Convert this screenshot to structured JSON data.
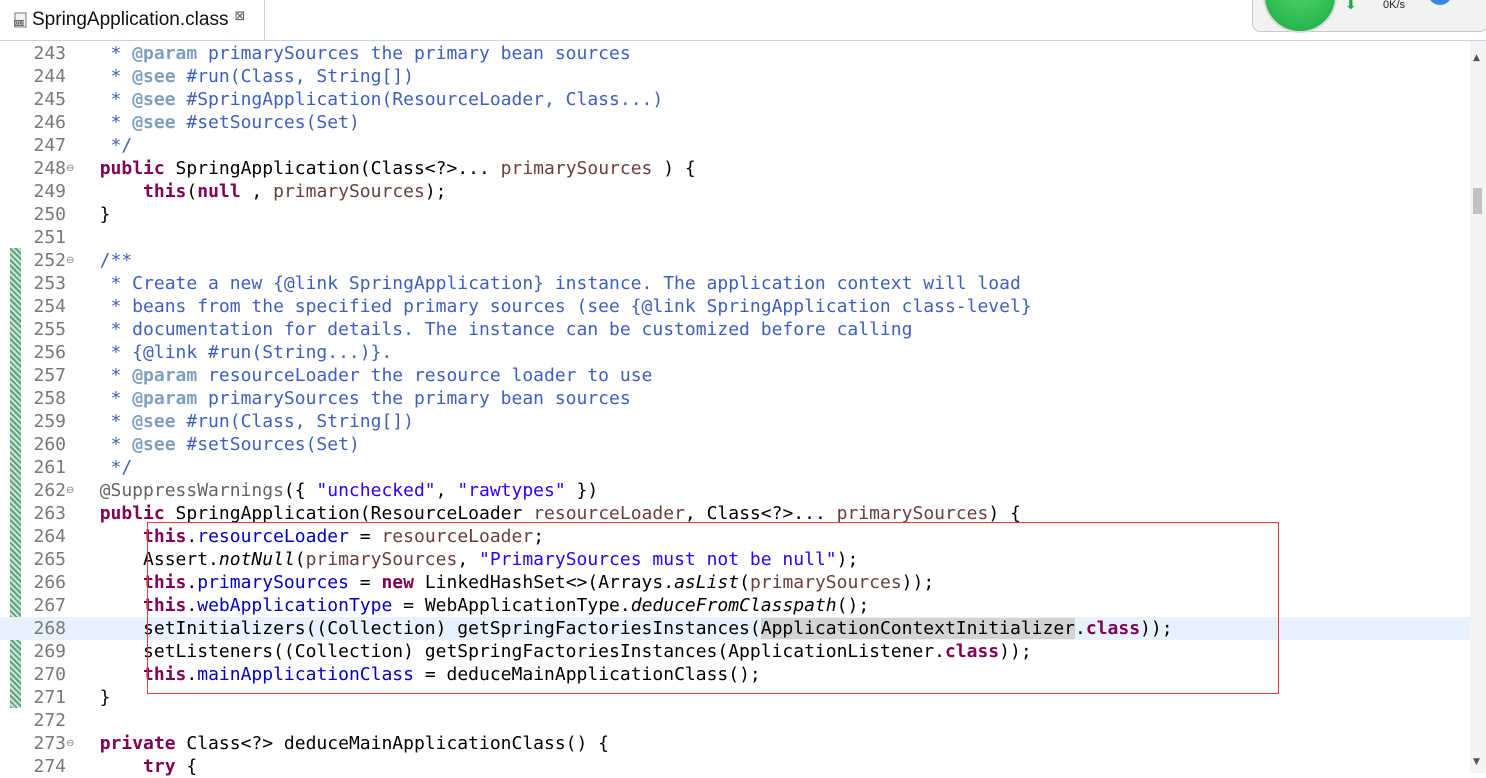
{
  "tab": {
    "label": "SpringApplication.class",
    "close": "⊠"
  },
  "widget": {
    "speed": "0K/s",
    "arrow": "⬇"
  },
  "lines": [
    {
      "n": "243",
      "fold": "",
      "tokens": [
        [
          "cm",
          "   * "
        ],
        [
          "tag",
          "@param"
        ],
        [
          "cm",
          " primarySources the primary bean sources"
        ]
      ]
    },
    {
      "n": "244",
      "fold": "",
      "tokens": [
        [
          "cm",
          "   * "
        ],
        [
          "tag",
          "@see"
        ],
        [
          "cm",
          " #run(Class, String[])"
        ]
      ]
    },
    {
      "n": "245",
      "fold": "",
      "tokens": [
        [
          "cm",
          "   * "
        ],
        [
          "tag",
          "@see"
        ],
        [
          "cm",
          " #SpringApplication(ResourceLoader, Class...)"
        ]
      ]
    },
    {
      "n": "246",
      "fold": "",
      "tokens": [
        [
          "cm",
          "   * "
        ],
        [
          "tag",
          "@see"
        ],
        [
          "cm",
          " #setSources(Set)"
        ]
      ]
    },
    {
      "n": "247",
      "fold": "",
      "tokens": [
        [
          "cm",
          "   */"
        ]
      ]
    },
    {
      "n": "248",
      "fold": "⊖",
      "tokens": [
        [
          "",
          "  "
        ],
        [
          "kw",
          "public"
        ],
        [
          "",
          " SpringApplication(Class<?>... "
        ],
        [
          "param",
          "primarySources"
        ],
        [
          "",
          " ) {"
        ]
      ]
    },
    {
      "n": "249",
      "fold": "",
      "tokens": [
        [
          "",
          "      "
        ],
        [
          "kw",
          "this"
        ],
        [
          "",
          "("
        ],
        [
          "kw",
          "null"
        ],
        [
          "",
          " , "
        ],
        [
          "param",
          "primarySources"
        ],
        [
          "",
          ");"
        ]
      ]
    },
    {
      "n": "250",
      "fold": "",
      "tokens": [
        [
          "",
          "  }"
        ]
      ]
    },
    {
      "n": "251",
      "fold": "",
      "tokens": [
        [
          "",
          ""
        ]
      ]
    },
    {
      "n": "252",
      "fold": "⊖",
      "tokens": [
        [
          "cm",
          "  /**"
        ]
      ]
    },
    {
      "n": "253",
      "fold": "",
      "tokens": [
        [
          "cm",
          "   * Create a new {@link SpringApplication} instance. The application context will load"
        ]
      ]
    },
    {
      "n": "254",
      "fold": "",
      "tokens": [
        [
          "cm",
          "   * beans from the specified primary sources (see {@link SpringApplication class-level}"
        ]
      ]
    },
    {
      "n": "255",
      "fold": "",
      "tokens": [
        [
          "cm",
          "   * documentation for details. The instance can be customized before calling"
        ]
      ]
    },
    {
      "n": "256",
      "fold": "",
      "tokens": [
        [
          "cm",
          "   * {@link #run(String...)}."
        ]
      ]
    },
    {
      "n": "257",
      "fold": "",
      "tokens": [
        [
          "cm",
          "   * "
        ],
        [
          "tag",
          "@param"
        ],
        [
          "cm",
          " resourceLoader the resource loader to use"
        ]
      ]
    },
    {
      "n": "258",
      "fold": "",
      "tokens": [
        [
          "cm",
          "   * "
        ],
        [
          "tag",
          "@param"
        ],
        [
          "cm",
          " primarySources the primary bean sources"
        ]
      ]
    },
    {
      "n": "259",
      "fold": "",
      "tokens": [
        [
          "cm",
          "   * "
        ],
        [
          "tag",
          "@see"
        ],
        [
          "cm",
          " #run(Class, String[])"
        ]
      ]
    },
    {
      "n": "260",
      "fold": "",
      "tokens": [
        [
          "cm",
          "   * "
        ],
        [
          "tag",
          "@see"
        ],
        [
          "cm",
          " #setSources(Set)"
        ]
      ]
    },
    {
      "n": "261",
      "fold": "",
      "tokens": [
        [
          "cm",
          "   */"
        ]
      ]
    },
    {
      "n": "262",
      "fold": "⊖",
      "tokens": [
        [
          "ann",
          "  @SuppressWarnings"
        ],
        [
          "",
          "({ "
        ],
        [
          "str",
          "\"unchecked\""
        ],
        [
          "",
          ", "
        ],
        [
          "str",
          "\"rawtypes\""
        ],
        [
          "",
          " })"
        ]
      ]
    },
    {
      "n": "263",
      "fold": "",
      "tokens": [
        [
          "",
          "  "
        ],
        [
          "kw",
          "public"
        ],
        [
          "",
          " SpringApplication(ResourceLoader "
        ],
        [
          "param",
          "resourceLoader"
        ],
        [
          "",
          ", Class<?>... "
        ],
        [
          "param",
          "primarySources"
        ],
        [
          "",
          ") {"
        ]
      ]
    },
    {
      "n": "264",
      "fold": "",
      "tokens": [
        [
          "",
          "      "
        ],
        [
          "kw",
          "this"
        ],
        [
          "",
          "."
        ],
        [
          "field",
          "resourceLoader"
        ],
        [
          "",
          " = "
        ],
        [
          "param",
          "resourceLoader"
        ],
        [
          "",
          ";"
        ]
      ]
    },
    {
      "n": "265",
      "fold": "",
      "tokens": [
        [
          "",
          "      Assert."
        ],
        [
          "it",
          "notNull"
        ],
        [
          "",
          "("
        ],
        [
          "param",
          "primarySources"
        ],
        [
          "",
          ", "
        ],
        [
          "str",
          "\"PrimarySources must not be null\""
        ],
        [
          "",
          ");"
        ]
      ]
    },
    {
      "n": "266",
      "fold": "",
      "tokens": [
        [
          "",
          "      "
        ],
        [
          "kw",
          "this"
        ],
        [
          "",
          "."
        ],
        [
          "field",
          "primarySources"
        ],
        [
          "",
          " = "
        ],
        [
          "kw",
          "new"
        ],
        [
          "",
          " LinkedHashSet<>(Arrays."
        ],
        [
          "it",
          "asList"
        ],
        [
          "",
          "("
        ],
        [
          "param",
          "primarySources"
        ],
        [
          "",
          "));"
        ]
      ]
    },
    {
      "n": "267",
      "fold": "",
      "tokens": [
        [
          "",
          "      "
        ],
        [
          "kw",
          "this"
        ],
        [
          "",
          "."
        ],
        [
          "field",
          "webApplicationType"
        ],
        [
          "",
          " = WebApplicationType."
        ],
        [
          "it",
          "deduceFromClasspath"
        ],
        [
          "",
          "();"
        ]
      ]
    },
    {
      "n": "268",
      "fold": "",
      "current": true,
      "tokens": [
        [
          "",
          "      setInitializers((Collection) getSpringFactoriesInstances("
        ],
        [
          "hl",
          "ApplicationContextInitializer"
        ],
        [
          "",
          "."
        ],
        [
          "kw",
          "class"
        ],
        [
          "",
          "));"
        ]
      ]
    },
    {
      "n": "269",
      "fold": "",
      "tokens": [
        [
          "",
          "      setListeners((Collection) getSpringFactoriesInstances(ApplicationListener."
        ],
        [
          "kw",
          "class"
        ],
        [
          "",
          "));"
        ]
      ]
    },
    {
      "n": "270",
      "fold": "",
      "tokens": [
        [
          "",
          "      "
        ],
        [
          "kw",
          "this"
        ],
        [
          "",
          "."
        ],
        [
          "field",
          "mainApplicationClass"
        ],
        [
          "",
          " = deduceMainApplicationClass();"
        ]
      ]
    },
    {
      "n": "271",
      "fold": "",
      "tokens": [
        [
          "",
          "  }"
        ]
      ]
    },
    {
      "n": "272",
      "fold": "",
      "tokens": [
        [
          "",
          ""
        ]
      ]
    },
    {
      "n": "273",
      "fold": "⊖",
      "tokens": [
        [
          "",
          "  "
        ],
        [
          "kw",
          "private"
        ],
        [
          "",
          " Class<?> deduceMainApplicationClass() {"
        ]
      ]
    },
    {
      "n": "274",
      "fold": "",
      "tokens": [
        [
          "",
          "      "
        ],
        [
          "kw",
          "try"
        ],
        [
          "",
          " {"
        ]
      ]
    }
  ]
}
